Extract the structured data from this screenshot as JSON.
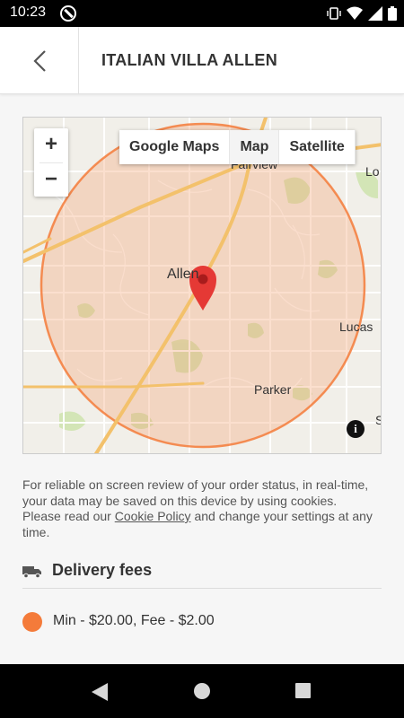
{
  "status_bar": {
    "time": "10:23"
  },
  "header": {
    "title": "ITALIAN VILLA ALLEN"
  },
  "map": {
    "type_options": [
      "Google Maps",
      "Map",
      "Satellite"
    ],
    "selected_type": "Map",
    "zoom_in_label": "+",
    "zoom_out_label": "−",
    "place_labels": {
      "fairview": "Fairview",
      "allen": "Allen",
      "lucas": "Lucas",
      "parker": "Parker",
      "lo": "Lo",
      "s": "S"
    },
    "info_label": "i",
    "zone_color": "#f47b3a",
    "pin_color": "#e53935"
  },
  "notice": {
    "before": "For reliable on screen review of your order status, in real-time, your data may be saved on this device by using cookies. Please read our ",
    "link": "Cookie Policy",
    "after": " and change your settings at any time."
  },
  "delivery": {
    "heading": "Delivery fees",
    "fees": [
      {
        "text": "Min - $20.00, Fee - $2.00",
        "color": "#f47b3a"
      }
    ]
  }
}
